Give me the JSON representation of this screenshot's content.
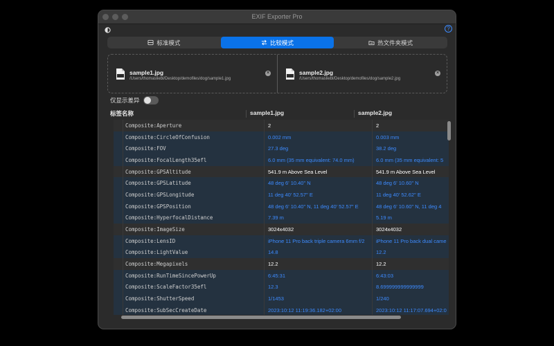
{
  "window": {
    "title": "EXIF Exporter Pro"
  },
  "tabs": [
    {
      "label": "标准模式",
      "icon": "standard-mode-icon",
      "active": false
    },
    {
      "label": "比较模式",
      "icon": "compare-arrows-icon",
      "active": true
    },
    {
      "label": "热文件夹模式",
      "icon": "hot-folder-icon",
      "active": false
    }
  ],
  "files": [
    {
      "name": "sample1.jpg",
      "path": "/Users/thomasliebl/Desktop/demofiles/dog/sample1.jpg"
    },
    {
      "name": "sample2.jpg",
      "path": "/Users/thomasliebl/Desktop/demofiles/dog/sample2.jpg"
    }
  ],
  "diff_toggle": {
    "label": "仅显示差异",
    "on": false
  },
  "table": {
    "headers": {
      "tag": "标签名称",
      "file1": "sample1.jpg",
      "file2": "sample2.jpg"
    },
    "rows": [
      {
        "tag": "Composite:Aperture",
        "v1": "2",
        "v2": "2",
        "diff": false
      },
      {
        "tag": "Composite:CircleOfConfusion",
        "v1": "0.002 mm",
        "v2": "0.003 mm",
        "diff": true
      },
      {
        "tag": "Composite:FOV",
        "v1": "27.3 deg",
        "v2": "38.2 deg",
        "diff": true
      },
      {
        "tag": "Composite:FocalLength35efl",
        "v1": "6.0 mm (35 mm equivalent: 74.0 mm)",
        "v2": "6.0 mm (35 mm equivalent: 5",
        "diff": true
      },
      {
        "tag": "Composite:GPSAltitude",
        "v1": "541.9 m Above Sea Level",
        "v2": "541.9 m Above Sea Level",
        "diff": false
      },
      {
        "tag": "Composite:GPSLatitude",
        "v1": "48 deg 6' 10.40\" N",
        "v2": "48 deg 6' 10.60\" N",
        "diff": true
      },
      {
        "tag": "Composite:GPSLongitude",
        "v1": "11 deg 40' 52.57\" E",
        "v2": "11 deg 40' 52.62\" E",
        "diff": true
      },
      {
        "tag": "Composite:GPSPosition",
        "v1": "48 deg 6' 10.40\" N, 11 deg 40' 52.57\" E",
        "v2": "48 deg 6' 10.60\" N, 11 deg 4",
        "diff": true
      },
      {
        "tag": "Composite:HyperfocalDistance",
        "v1": "7.39 m",
        "v2": "5.19 m",
        "diff": true
      },
      {
        "tag": "Composite:ImageSize",
        "v1": "3024x4032",
        "v2": "3024x4032",
        "diff": false
      },
      {
        "tag": "Composite:LensID",
        "v1": "iPhone 11 Pro back triple camera 6mm f/2",
        "v2": "iPhone 11 Pro back dual came",
        "diff": true
      },
      {
        "tag": "Composite:LightValue",
        "v1": "14.8",
        "v2": "12.2",
        "diff": true
      },
      {
        "tag": "Composite:Megapixels",
        "v1": "12.2",
        "v2": "12.2",
        "diff": false
      },
      {
        "tag": "Composite:RunTimeSincePowerUp",
        "v1": "6:45:31",
        "v2": "6:43:03",
        "diff": true
      },
      {
        "tag": "Composite:ScaleFactor35efl",
        "v1": "12.3",
        "v2": "8.699999999999999",
        "diff": true
      },
      {
        "tag": "Composite:ShutterSpeed",
        "v1": "1/1453",
        "v2": "1/240",
        "diff": true
      },
      {
        "tag": "Composite:SubSecCreateDate",
        "v1": "2023:10:12 11:19:36.182+02:00",
        "v2": "2023:10:12 11:17:07.694+02:0",
        "diff": true
      }
    ]
  },
  "colors": {
    "accent": "#0a72e8",
    "diff_text": "#3d8bff",
    "background": "#2b2b2b"
  },
  "icons": {
    "theme": "half-circle-icon",
    "help": "question-mark-icon",
    "file": "jpg-file-icon",
    "close": "close-icon"
  }
}
